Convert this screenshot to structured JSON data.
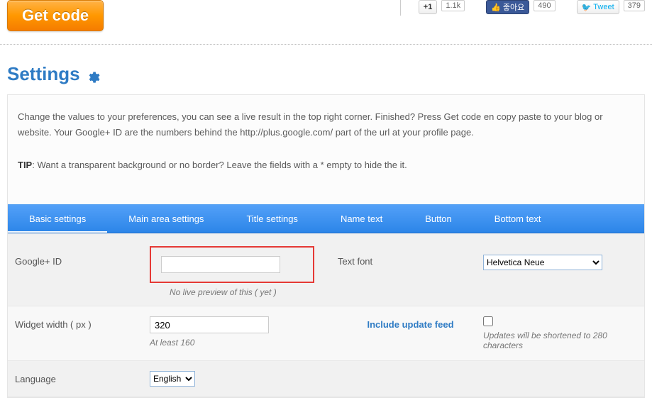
{
  "header": {
    "get_code_label": "Get code"
  },
  "social": {
    "plus1_label": "+1",
    "plus1_count": "1.1k",
    "like_label": "좋아요",
    "like_count": "490",
    "tweet_label": "Tweet",
    "tweet_count": "379"
  },
  "title": "Settings",
  "help": {
    "line1": "Change the values to your preferences, you can see a live result in the top right corner. Finished? Press Get code en copy paste to your blog or website. Your Google+ ID are the numbers behind the http://plus.google.com/ part of the url at your profile page.",
    "tip_label": "TIP",
    "tip_text": ": Want a transparent background or no border? Leave the fields with a * empty to hide the it."
  },
  "tabs": [
    {
      "label": "Basic settings",
      "active": true
    },
    {
      "label": "Main area settings",
      "active": false
    },
    {
      "label": "Title settings",
      "active": false
    },
    {
      "label": "Name text",
      "active": false
    },
    {
      "label": "Button",
      "active": false
    },
    {
      "label": "Bottom text",
      "active": false
    }
  ],
  "fields": {
    "google_id": {
      "label": "Google+ ID",
      "value": "",
      "hint": "No live preview of this ( yet )"
    },
    "text_font": {
      "label": "Text font",
      "value": "Helvetica Neue"
    },
    "widget_width": {
      "label": "Widget width ( px )",
      "value": "320",
      "hint": "At least 160"
    },
    "include_feed": {
      "label": "Include update feed",
      "checked": false,
      "hint": "Updates will be shortened to 280 characters"
    },
    "language": {
      "label": "Language",
      "value": "English"
    }
  }
}
